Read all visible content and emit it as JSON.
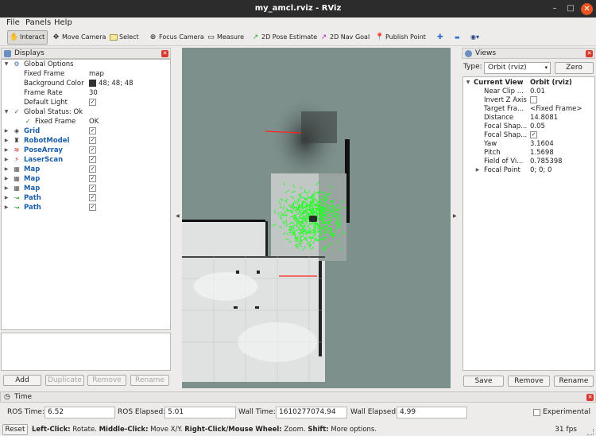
{
  "window": {
    "title": "my_amcl.rviz - RViz",
    "minimize": "–",
    "maximize": "□",
    "close": "✕"
  },
  "menu": {
    "file": "File",
    "panels": "Panels",
    "help": "Help"
  },
  "toolbar": {
    "interact": "Interact",
    "move_camera": "Move Camera",
    "select": "Select",
    "focus_camera": "Focus Camera",
    "measure": "Measure",
    "pose_estimate": "2D Pose Estimate",
    "nav_goal": "2D Nav Goal",
    "publish_point": "Publish Point",
    "plus_icon": "plus-icon",
    "minus_icon": "minus-icon",
    "eye_icon": "eye-icon",
    "plus": "✚",
    "minus": "▬",
    "eye": "◉▾"
  },
  "displays": {
    "title": "Displays",
    "global_options": "Global Options",
    "fixed_frame_label": "Fixed Frame",
    "fixed_frame_value": "map",
    "background_color_label": "Background Color",
    "background_color_value": "48; 48; 48",
    "background_color_hex": "#303030",
    "frame_rate_label": "Frame Rate",
    "frame_rate_value": "30",
    "default_light_label": "Default Light",
    "global_status": "Global Status: Ok",
    "status_fixed_frame_label": "Fixed Frame",
    "status_fixed_frame_value": "OK",
    "items": [
      {
        "label": "Grid",
        "icon": "grid-icon"
      },
      {
        "label": "RobotModel",
        "icon": "robot-model-icon"
      },
      {
        "label": "PoseArray",
        "icon": "pose-array-icon"
      },
      {
        "label": "LaserScan",
        "icon": "laser-scan-icon"
      },
      {
        "label": "Map",
        "icon": "map-icon"
      },
      {
        "label": "Map",
        "icon": "map-icon"
      },
      {
        "label": "Map",
        "icon": "map-icon"
      },
      {
        "label": "Path",
        "icon": "path-icon"
      },
      {
        "label": "Path",
        "icon": "path-icon"
      }
    ],
    "check": "✓",
    "buttons": {
      "add": "Add",
      "duplicate": "Duplicate",
      "remove": "Remove",
      "rename": "Rename"
    }
  },
  "views": {
    "title": "Views",
    "type_label": "Type:",
    "type_value": "Orbit (rviz)",
    "zero": "Zero",
    "current_view_label": "Current View",
    "current_view_value": "Orbit (rviz)",
    "props": [
      {
        "label": "Near Clip ...",
        "value": "0.01"
      },
      {
        "label": "Invert Z Axis",
        "value": ""
      },
      {
        "label": "Target Fra...",
        "value": "<Fixed Frame>"
      },
      {
        "label": "Distance",
        "value": "14.8081"
      },
      {
        "label": "Focal Shap...",
        "value": "0.05"
      },
      {
        "label": "Focal Shap...",
        "value": "✓"
      },
      {
        "label": "Yaw",
        "value": "3.1604"
      },
      {
        "label": "Pitch",
        "value": "1.5698"
      },
      {
        "label": "Field of Vi...",
        "value": "0.785398"
      },
      {
        "label": "Focal Point",
        "value": "0; 0; 0"
      }
    ],
    "buttons": {
      "save": "Save",
      "remove": "Remove",
      "rename": "Rename"
    }
  },
  "time": {
    "title": "Time",
    "ros_time_label": "ROS Time:",
    "ros_time": "6.52",
    "ros_elapsed_label": "ROS Elapsed:",
    "ros_elapsed": "5.01",
    "wall_time_label": "Wall Time:",
    "wall_time": "1610277074.94",
    "wall_elapsed_label": "Wall Elapsed:",
    "wall_elapsed": "4.99",
    "experimental": "Experimental"
  },
  "status": {
    "reset": "Reset",
    "left_click": "Left-Click:",
    "left_click_desc": " Rotate. ",
    "middle_click": "Middle-Click:",
    "middle_click_desc": " Move X/Y. ",
    "right_click": "Right-Click/Mouse Wheel:",
    "right_click_desc": " Zoom. ",
    "shift": "Shift:",
    "shift_desc": " More options.",
    "fps": "31 fps"
  },
  "colors": {
    "particles": "#22ff22",
    "laser": "#ff2222",
    "viewport_bg": "#7d908c"
  }
}
